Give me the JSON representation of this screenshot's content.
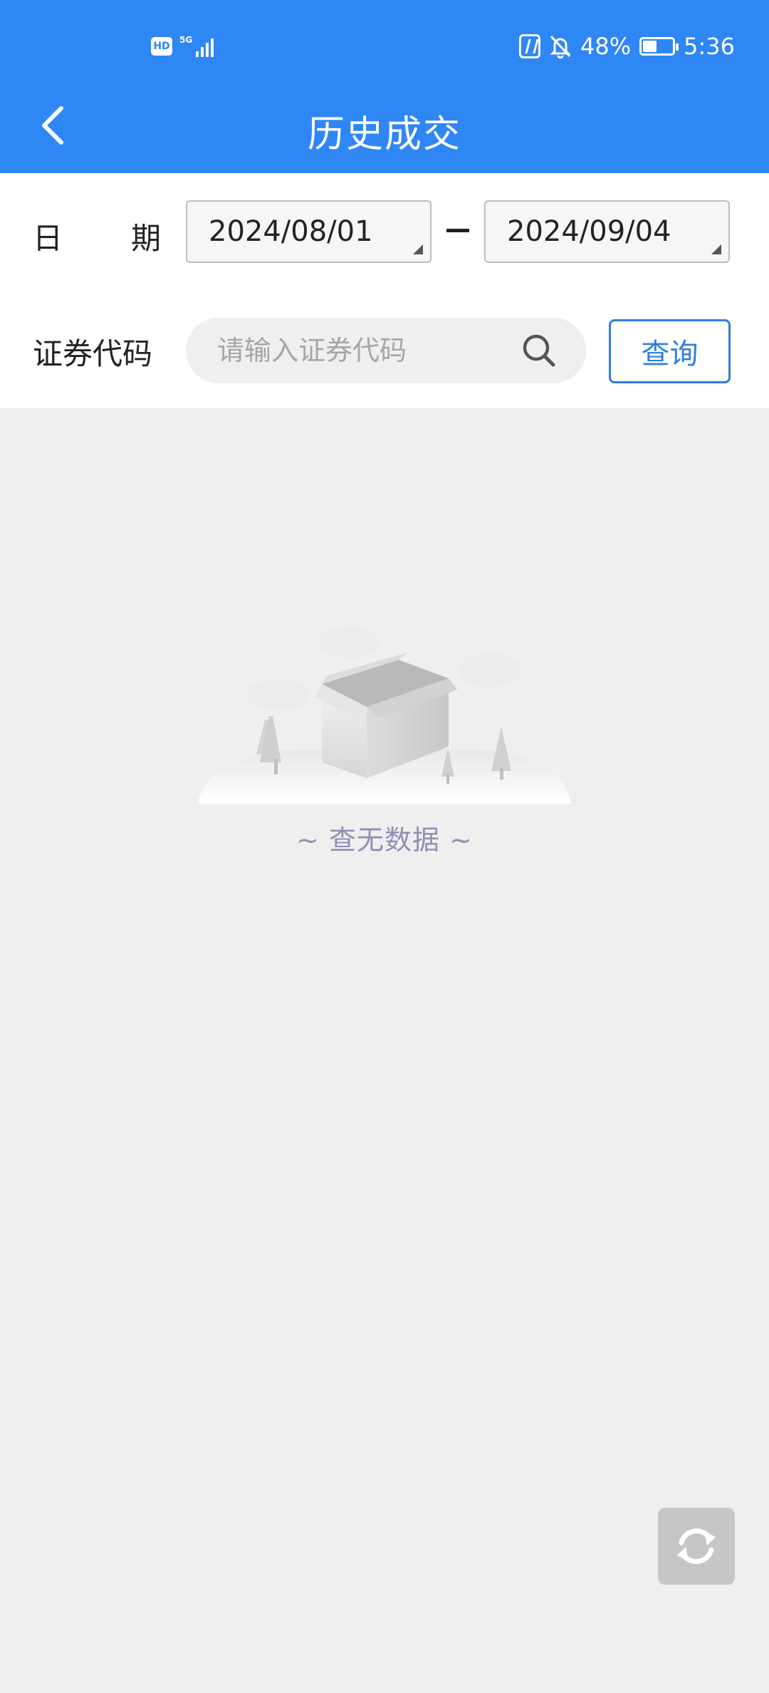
{
  "status_bar": {
    "network": "5G",
    "hd": "HD",
    "battery_percent": "48%",
    "battery_level": 0.48,
    "time": "5:36"
  },
  "header": {
    "title": "历史成交",
    "back_icon": "chevron-left-icon"
  },
  "form": {
    "date_label_first": "日",
    "date_label_second": "期",
    "start_date": "2024/08/01",
    "end_date": "2024/09/04",
    "code_label": "证券代码",
    "search_placeholder": "请输入证券代码",
    "search_value": "",
    "query_button": "查询"
  },
  "empty_state": {
    "message": "~ 查无数据 ~",
    "illustration": "empty-box-icon"
  },
  "floating": {
    "refresh_icon": "refresh-icon"
  },
  "colors": {
    "primary": "#2f86f5",
    "page_bg": "#efefef",
    "empty_text": "#8f8fb8"
  }
}
